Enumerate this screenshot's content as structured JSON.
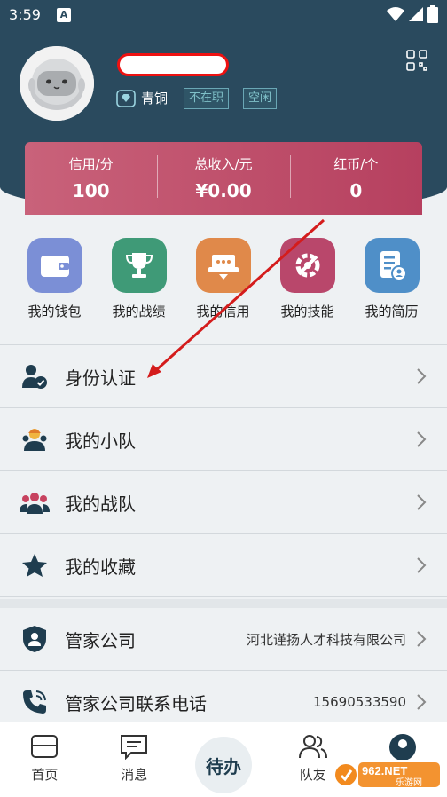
{
  "status": {
    "time": "3:59",
    "notif": "A"
  },
  "user": {
    "level": "青铜",
    "tags": [
      "不在职",
      "空闲"
    ]
  },
  "stats": [
    {
      "label": "信用/分",
      "value": "100"
    },
    {
      "label": "总收入/元",
      "value": "¥0.00"
    },
    {
      "label": "红币/个",
      "value": "0"
    }
  ],
  "quick": [
    {
      "label": "我的钱包",
      "icon": "wallet-icon",
      "color": "#7b8fd6"
    },
    {
      "label": "我的战绩",
      "icon": "trophy-icon",
      "color": "#3f9a77"
    },
    {
      "label": "我的信用",
      "icon": "credit-icon",
      "color": "#e0894a"
    },
    {
      "label": "我的技能",
      "icon": "skill-icon",
      "color": "#b9476b"
    },
    {
      "label": "我的简历",
      "icon": "resume-icon",
      "color": "#4f8fc8"
    }
  ],
  "menu": [
    {
      "label": "身份认证",
      "value": ""
    },
    {
      "label": "我的小队",
      "value": ""
    },
    {
      "label": "我的战队",
      "value": ""
    },
    {
      "label": "我的收藏",
      "value": ""
    },
    {
      "label": "管家公司",
      "value": "河北谨扬人才科技有限公司"
    },
    {
      "label": "管家公司联系电话",
      "value": "15690533590"
    }
  ],
  "tabs": {
    "home": "首页",
    "messages": "消息",
    "todo": "待办",
    "teammates": "队友"
  },
  "watermark": {
    "brand": "962.NET",
    "sub": "乐游网"
  },
  "colors": {
    "header": "#2a4a5e",
    "stats_gradient_start": "#c9627a",
    "stats_gradient_end": "#b6405f",
    "annotation_arrow": "#d41c1c"
  }
}
